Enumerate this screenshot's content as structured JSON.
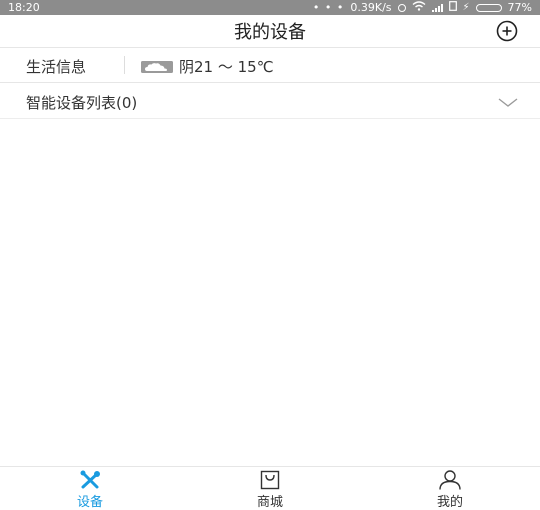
{
  "status_bar": {
    "time": "18:20",
    "dots": "• • •",
    "network_speed": "0.39K/s",
    "battery_percent": "77%",
    "battery_level": 0.77
  },
  "header": {
    "title": "我的设备",
    "add_icon": "plus-circle-icon"
  },
  "weather": {
    "label": "生活信息",
    "icon": "cloud-icon",
    "text": "阴21 ～ 15℃"
  },
  "device_list": {
    "label": "智能设备列表(0)",
    "icon": "chevron-down-icon"
  },
  "tabs": [
    {
      "label": "设备",
      "icon": "wrench-screwdriver-icon",
      "active": true
    },
    {
      "label": "商城",
      "icon": "shopping-bag-icon",
      "active": false
    },
    {
      "label": "我的",
      "icon": "user-icon",
      "active": false
    }
  ],
  "colors": {
    "status_bar": "#8c8c8c",
    "accent": "#1a9be0",
    "battery": "#4cd964"
  }
}
